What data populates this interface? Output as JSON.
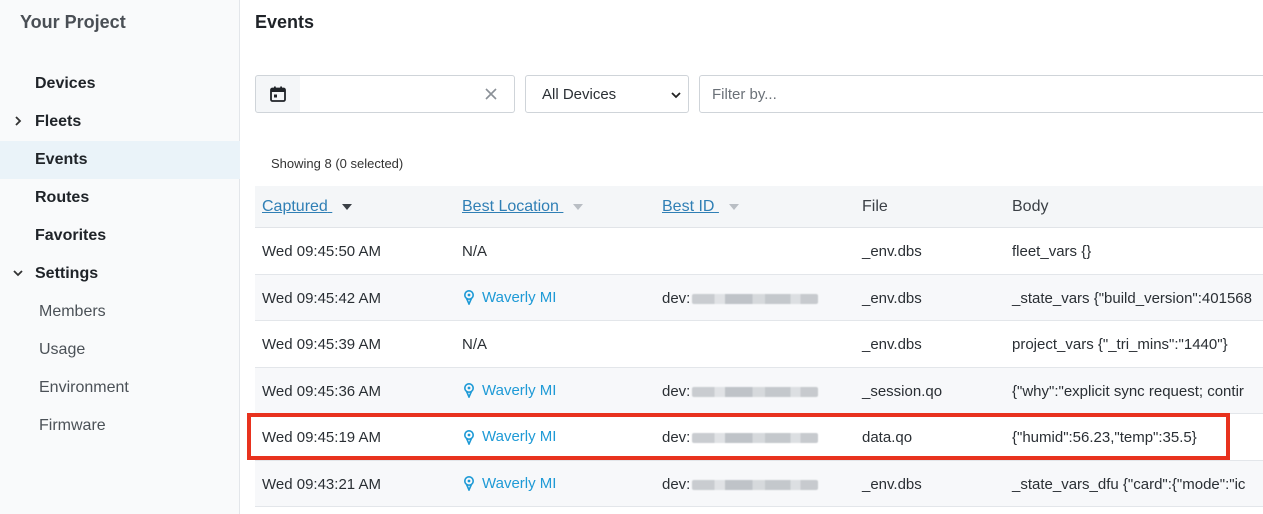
{
  "sidebar": {
    "project_title": "Your Project",
    "items": [
      {
        "label": "Devices"
      },
      {
        "label": "Fleets"
      },
      {
        "label": "Events"
      },
      {
        "label": "Routes"
      },
      {
        "label": "Favorites"
      },
      {
        "label": "Settings"
      },
      {
        "label": "Members"
      },
      {
        "label": "Usage"
      },
      {
        "label": "Environment"
      },
      {
        "label": "Firmware"
      }
    ]
  },
  "main": {
    "title": "Events",
    "filters": {
      "date_value": "",
      "device_select": "All Devices",
      "filter_placeholder": "Filter by..."
    },
    "showing": "Showing 8 (0 selected)",
    "columns": [
      "Captured",
      "Best Location",
      "Best ID",
      "File",
      "Body"
    ],
    "rows": [
      {
        "captured": "Wed 09:45:50 AM",
        "location": "N/A",
        "best_id": "",
        "file": "_env.dbs",
        "body": "fleet_vars {}"
      },
      {
        "captured": "Wed 09:45:42 AM",
        "location": "Waverly MI",
        "best_id": "dev:",
        "file": "_env.dbs",
        "body": "_state_vars {\"build_version\":401568"
      },
      {
        "captured": "Wed 09:45:39 AM",
        "location": "N/A",
        "best_id": "",
        "file": "_env.dbs",
        "body": "project_vars {\"_tri_mins\":\"1440\"}"
      },
      {
        "captured": "Wed 09:45:36 AM",
        "location": "Waverly MI",
        "best_id": "dev:",
        "file": "_session.qo",
        "body": "{\"why\":\"explicit sync request; contir"
      },
      {
        "captured": "Wed 09:45:19 AM",
        "location": "Waverly MI",
        "best_id": "dev:",
        "file": "data.qo",
        "body": "{\"humid\":56.23,\"temp\":35.5}"
      },
      {
        "captured": "Wed 09:43:21 AM",
        "location": "Waverly MI",
        "best_id": "dev:",
        "file": "_env.dbs",
        "body": "_state_vars_dfu {\"card\":{\"mode\":\"ic"
      }
    ]
  },
  "colors": {
    "accent": "#1e9ad6",
    "link": "#2f7fb5",
    "highlight": "#e8321e"
  }
}
